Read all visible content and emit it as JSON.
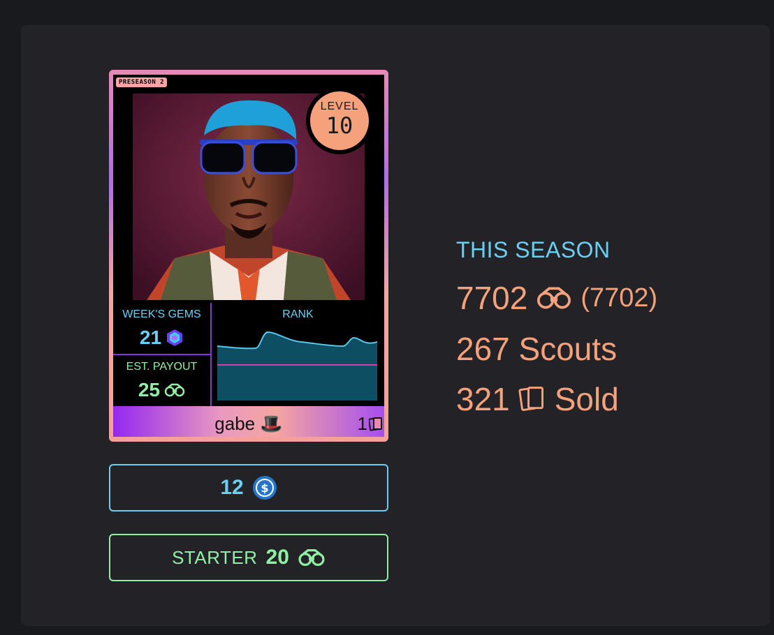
{
  "card": {
    "season_tag": "PRESEASON 2",
    "level_label": "LEVEL",
    "level_value": "10",
    "gems_title": "WEEK'S GEMS",
    "gems_value": "21",
    "payout_title": "EST. PAYOUT",
    "payout_value": "25",
    "rank_title": "RANK",
    "name": "gabe 🎩",
    "count": "1"
  },
  "buttons": {
    "price_value": "12",
    "starter_label": "STARTER",
    "starter_value": "20"
  },
  "season": {
    "title": "THIS SEASON",
    "points": "7702",
    "points_total": "(7702)",
    "scouts": "267 Scouts",
    "sold_count": "321",
    "sold_label": "Sold"
  },
  "colors": {
    "accent_blue": "#6ad0f3",
    "accent_green": "#8ff0a4",
    "accent_peach": "#f5a17c",
    "purple": "#8b2fe6"
  },
  "icons": {
    "gem": "gem-icon",
    "binoculars": "binoculars-icon",
    "cards": "cards-icon",
    "usdc": "usdc-coin-icon",
    "top_hat": "top-hat-emoji"
  }
}
